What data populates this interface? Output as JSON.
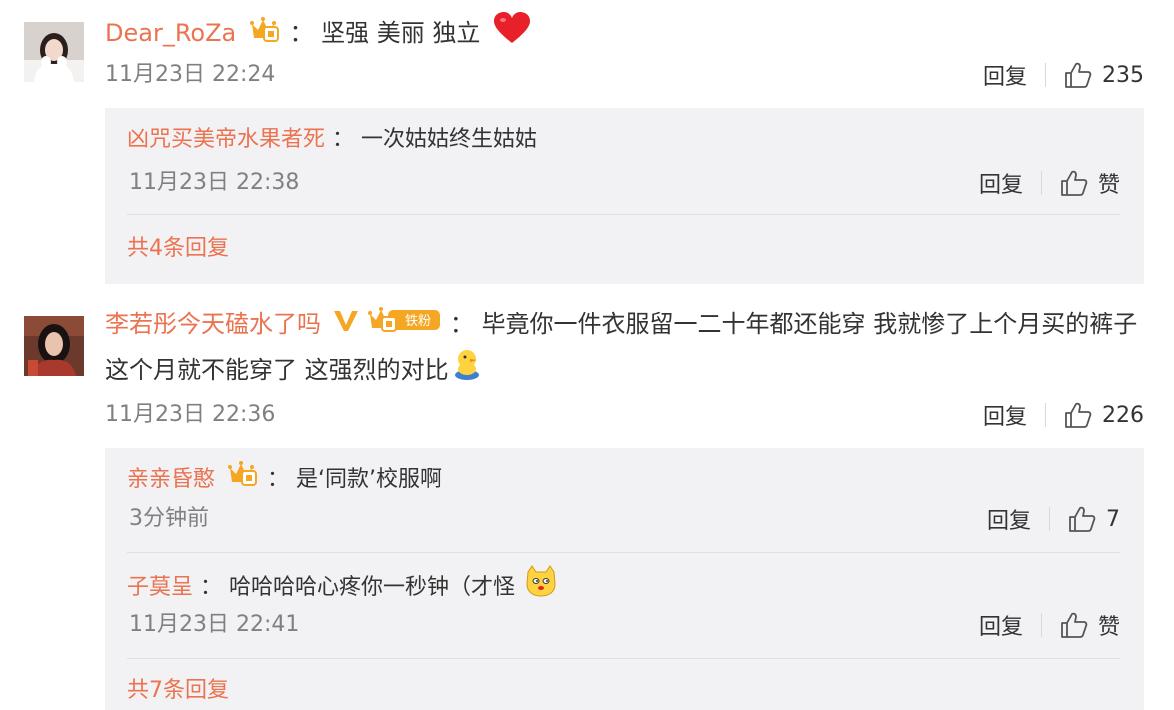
{
  "comments": [
    {
      "avatar": "avatar-girl-white-outfit",
      "username": "Dear_RoZa",
      "badge": "crown-vip-badge",
      "colon": "：",
      "text": "坚强 美丽 独立",
      "emoji": "heart-emoji",
      "time": "11月23日 22:24",
      "reply_label": "回复",
      "likes": "235",
      "replies": [
        {
          "username": "凶咒买美帝水果者死",
          "colon": "：",
          "text": "一次姑姑终生姑姑",
          "time": "11月23日 22:38",
          "reply_label": "回复",
          "likes": "赞"
        }
      ],
      "more_label": "共4条回复"
    },
    {
      "avatar": "avatar-girl-dark-hair",
      "username": "李若彤今天磕水了吗",
      "verified": "v-verified-badge",
      "badge": "crown-fan-badge",
      "fan_label": "铁粉",
      "colon": "：",
      "text": "毕竟你一件衣服留一二十年都还能穿 我就惨了上个月买的裤子这个月就不能穿了 这强烈的对比",
      "emoji": "duck-emoji",
      "time": "11月23日 22:36",
      "reply_label": "回复",
      "likes": "226",
      "replies": [
        {
          "username": "亲亲昏憨",
          "badge": "crown-vip-badge",
          "colon": "：",
          "text": "是‘同款’校服啊",
          "time": "3分钟前",
          "reply_label": "回复",
          "likes": "7"
        },
        {
          "username": "子莫呈",
          "colon": "：",
          "text": "哈哈哈哈心疼你一秒钟（才怪",
          "emoji": "doge-emoji",
          "time": "11月23日 22:41",
          "reply_label": "回复",
          "likes": "赞"
        }
      ],
      "more_label": "共7条回复"
    }
  ],
  "colors": {
    "username": "#eb7350",
    "text": "#333333",
    "time": "#808080",
    "reply_bg": "#f2f2f5",
    "badge_gold": "#f5a623",
    "heart": "#e8202a"
  }
}
